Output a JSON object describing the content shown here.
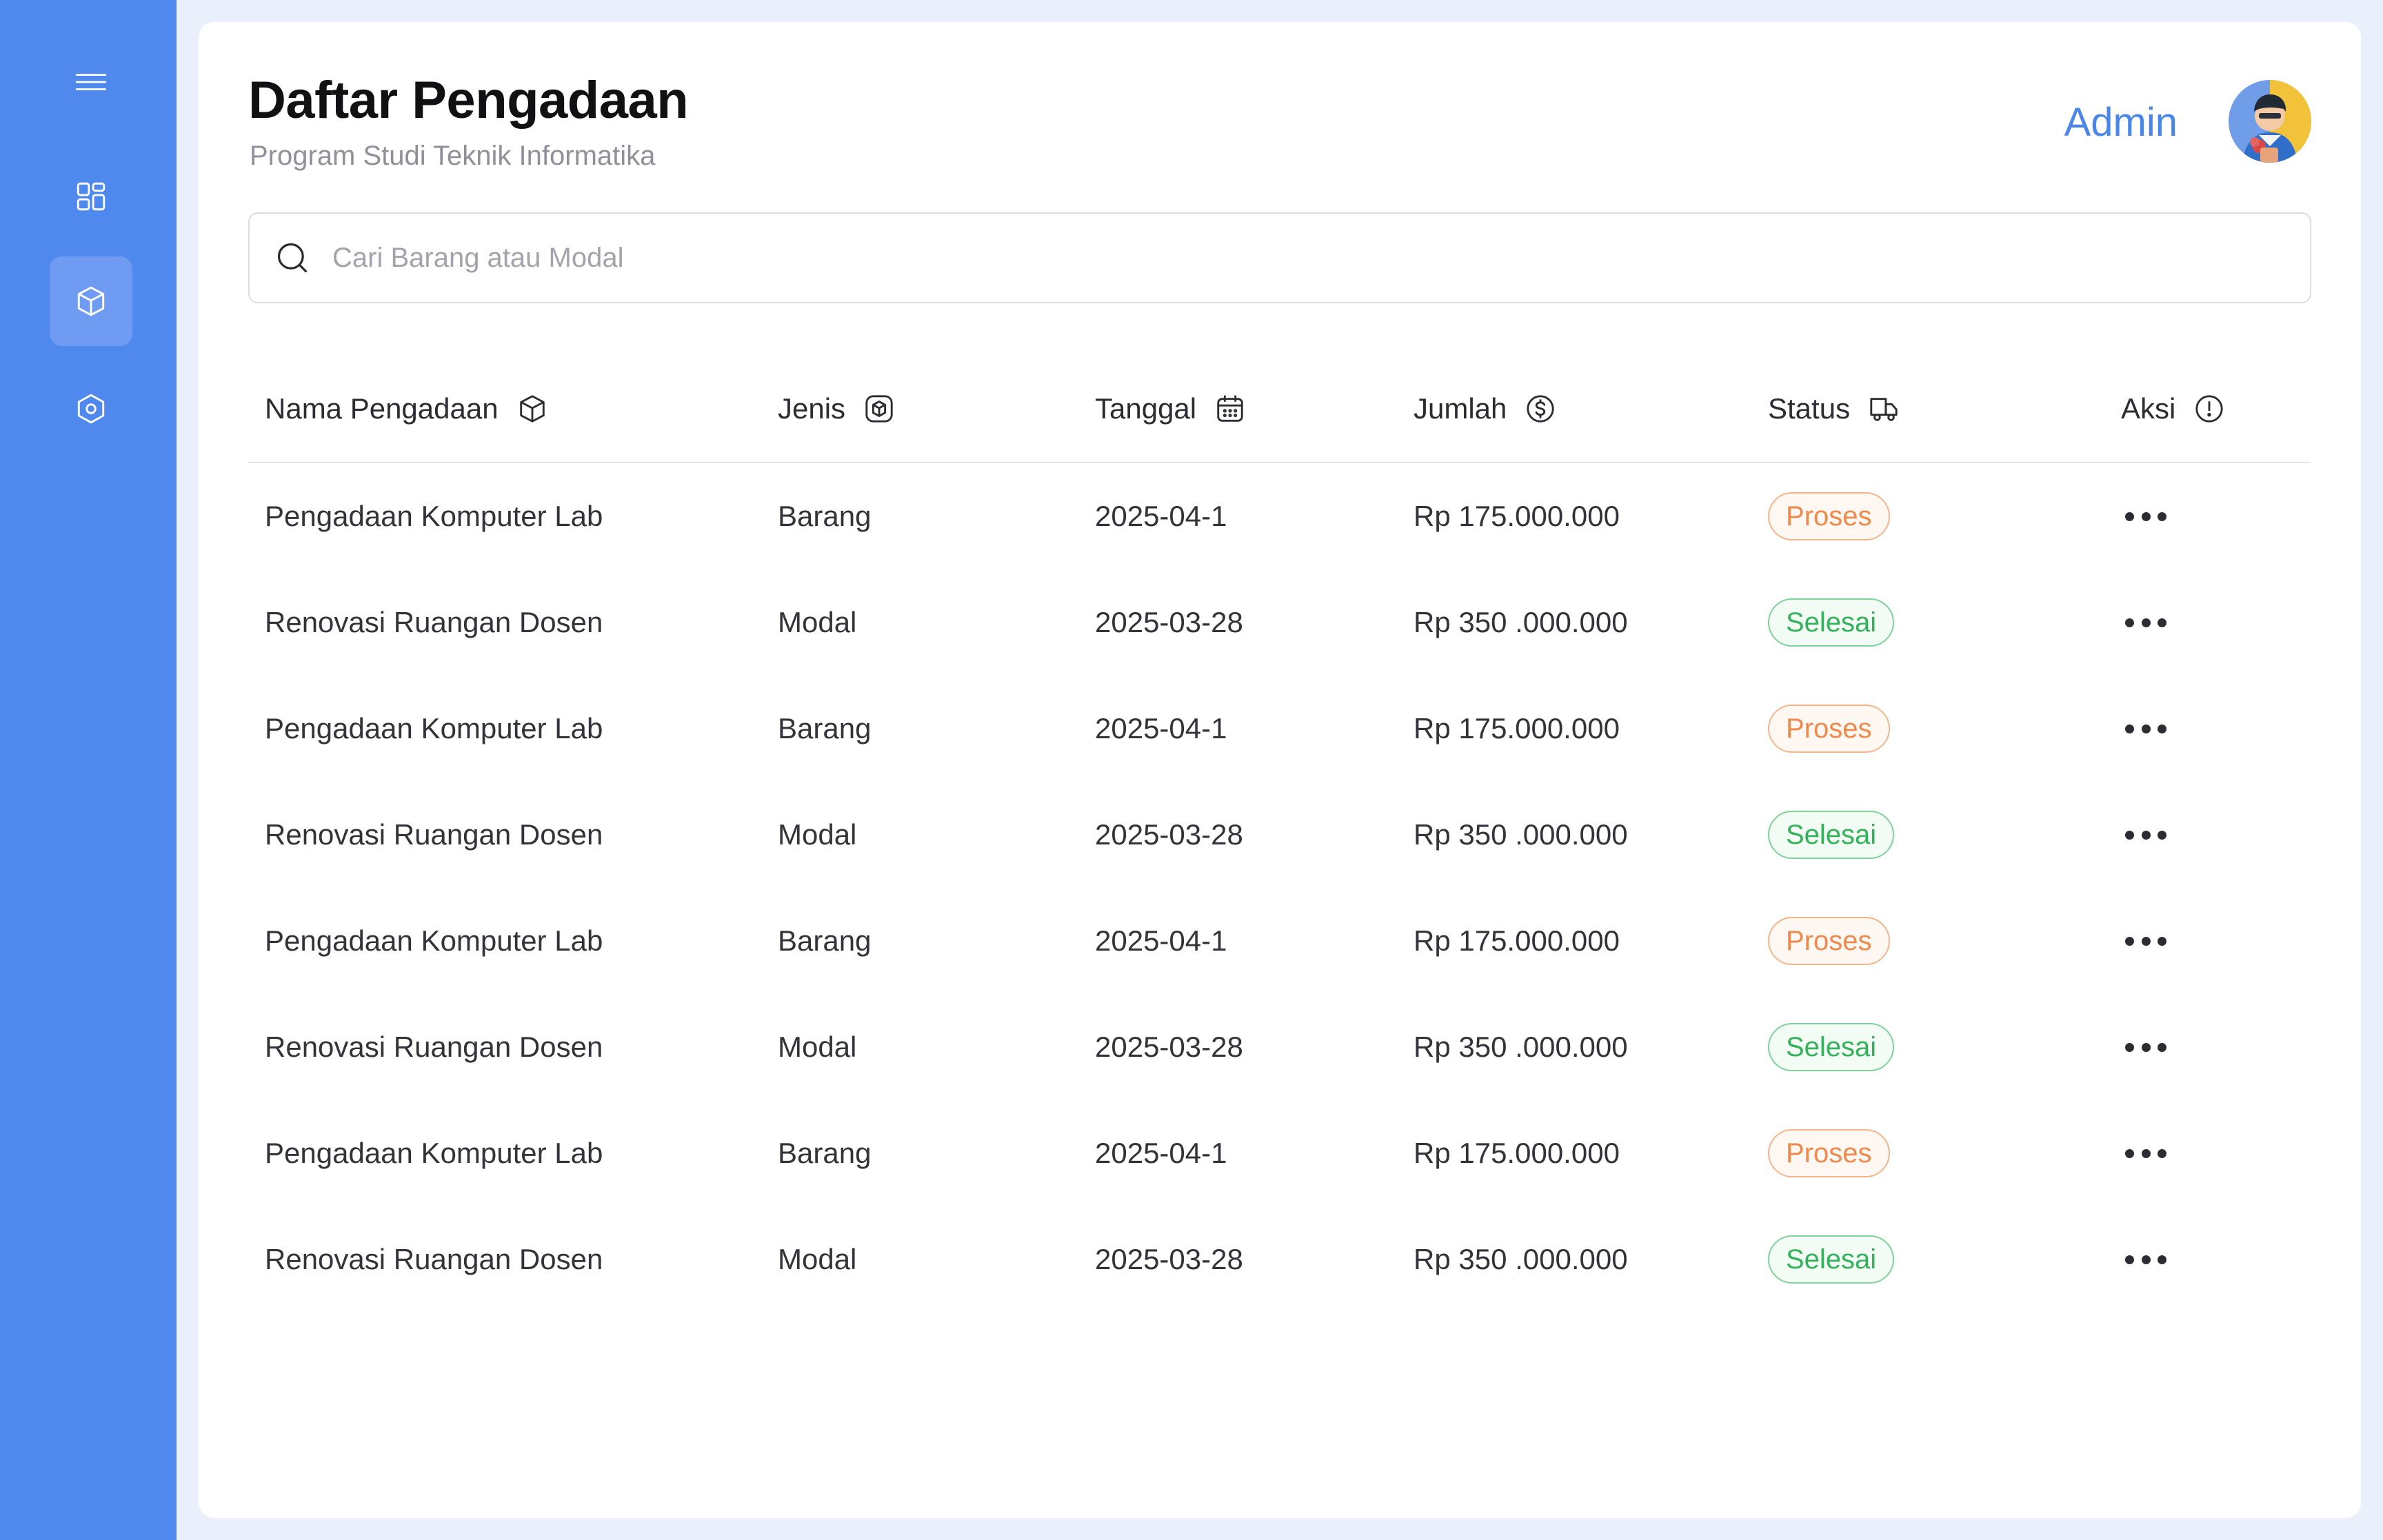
{
  "header": {
    "title": "Daftar Pengadaan",
    "subtitle": "Program Studi Teknik Informatika",
    "user_name": "Admin"
  },
  "sidebar": {
    "items": [
      {
        "name": "menu",
        "icon": "hamburger-menu-icon"
      },
      {
        "name": "dashboard",
        "icon": "dashboard-grid-icon"
      },
      {
        "name": "procurement",
        "icon": "box-icon",
        "active": true
      },
      {
        "name": "settings",
        "icon": "hexagon-settings-icon"
      }
    ]
  },
  "search": {
    "placeholder": "Cari Barang atau Modal",
    "value": ""
  },
  "table": {
    "columns": [
      {
        "label": "Nama Pengadaan",
        "icon": "box-icon"
      },
      {
        "label": "Jenis",
        "icon": "category-box-icon"
      },
      {
        "label": "Tanggal",
        "icon": "calendar-icon"
      },
      {
        "label": "Jumlah",
        "icon": "dollar-circle-icon"
      },
      {
        "label": "Status",
        "icon": "truck-icon"
      },
      {
        "label": "Aksi",
        "icon": "info-circle-icon"
      }
    ],
    "rows": [
      {
        "name": "Pengadaan Komputer Lab",
        "type": "Barang",
        "date": "2025-04-1",
        "amount": "Rp 175.000.000",
        "status": "Proses"
      },
      {
        "name": "Renovasi Ruangan Dosen",
        "type": "Modal",
        "date": "2025-03-28",
        "amount": "Rp 350 .000.000",
        "status": "Selesai"
      },
      {
        "name": "Pengadaan Komputer Lab",
        "type": "Barang",
        "date": "2025-04-1",
        "amount": "Rp 175.000.000",
        "status": "Proses"
      },
      {
        "name": "Renovasi Ruangan Dosen",
        "type": "Modal",
        "date": "2025-03-28",
        "amount": "Rp 350 .000.000",
        "status": "Selesai"
      },
      {
        "name": "Pengadaan Komputer Lab",
        "type": "Barang",
        "date": "2025-04-1",
        "amount": "Rp 175.000.000",
        "status": "Proses"
      },
      {
        "name": "Renovasi Ruangan Dosen",
        "type": "Modal",
        "date": "2025-03-28",
        "amount": "Rp 350 .000.000",
        "status": "Selesai"
      },
      {
        "name": "Pengadaan Komputer Lab",
        "type": "Barang",
        "date": "2025-04-1",
        "amount": "Rp 175.000.000",
        "status": "Proses"
      },
      {
        "name": "Renovasi Ruangan Dosen",
        "type": "Modal",
        "date": "2025-03-28",
        "amount": "Rp 350 .000.000",
        "status": "Selesai"
      }
    ]
  },
  "colors": {
    "sidebar": "#5089ee",
    "accent": "#4a86ea",
    "status_proses": "#ee8a4c",
    "status_selesai": "#34b25a"
  }
}
